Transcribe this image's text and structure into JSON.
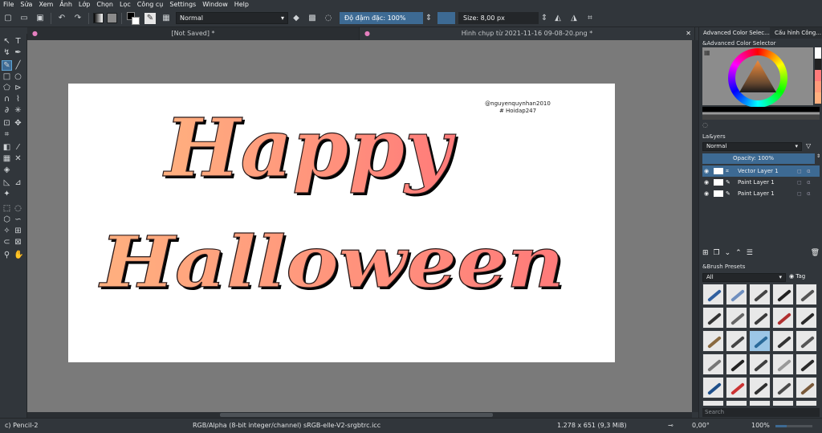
{
  "menu": [
    "File",
    "Sửa",
    "Xem",
    "Ảnh",
    "Lớp",
    "Chọn",
    "Lọc",
    "Công cụ",
    "Settings",
    "Window",
    "Help"
  ],
  "toolbar": {
    "blend_mode": "Normal",
    "opacity": "Độ đậm đặc: 100%",
    "size": "Size: 8,00 px",
    "fg_color": "#000000",
    "bg_color": "#ffffff"
  },
  "tabs": [
    {
      "label": "[Not Saved]  *"
    },
    {
      "label": "Hình chụp từ 2021-11-16 09-08-20.png *"
    }
  ],
  "canvas": {
    "line1": "Happy",
    "line2": "Halloween",
    "credit_name": "@nguyenquynhan2010",
    "credit_tag": "# Hoidap247",
    "paper_color": "#ffffff",
    "gradient_start": "#ffb07f",
    "gradient_end": "#ff7a7a"
  },
  "right_panel": {
    "tab_color": "Advanced Color Selec...",
    "tab_tools": "Cấu hình Công...",
    "color_title": "&Advanced Color Selector",
    "layers_title": "La&yers",
    "layers_blend": "Normal",
    "layers_opacity": "Opacity:  100%",
    "layers": [
      {
        "name": "Vector Layer 1",
        "selected": true
      },
      {
        "name": "Paint Layer 1",
        "selected": false
      },
      {
        "name": "Paint Layer 1",
        "selected": false
      }
    ],
    "brush_title": "&Brush Presets",
    "brush_filter": "All",
    "brush_tag": "Tag",
    "search_placeholder": "Search"
  },
  "status": {
    "tool": "c) Pencil-2",
    "colorspace": "RGB/Alpha (8-bit integer/channel)  sRGB-elle-V2-srgbtrc.icc",
    "size": "1.278 x 651 (9,3 MiB)",
    "angle": "0,00°",
    "zoom": "100%"
  }
}
